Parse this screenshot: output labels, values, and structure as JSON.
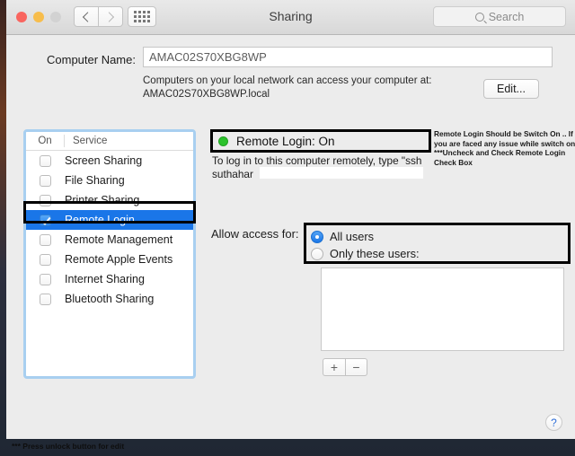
{
  "window": {
    "title": "Sharing",
    "traffic_lights": [
      "close-red",
      "minimize-yellow",
      "zoom-gray"
    ],
    "nav": {
      "back": "back-chevron",
      "forward": "forward-chevron",
      "grid": "show-all-grid"
    },
    "search": {
      "placeholder": "Search",
      "icon": "search-icon"
    }
  },
  "computer_name": {
    "label": "Computer Name:",
    "value": "AMAC02S70XBG8WP",
    "hint_line1": "Computers on your local network can access your computer at:",
    "hint_line2": "AMAC02S70XBG8WP.local",
    "edit_button": "Edit..."
  },
  "services": {
    "header": {
      "on": "On",
      "service": "Service"
    },
    "items": [
      {
        "label": "Screen Sharing",
        "checked": false,
        "selected": false
      },
      {
        "label": "File Sharing",
        "checked": false,
        "selected": false
      },
      {
        "label": "Printer Sharing",
        "checked": false,
        "selected": false
      },
      {
        "label": "Remote Login",
        "checked": true,
        "selected": true
      },
      {
        "label": "Remote Management",
        "checked": false,
        "selected": false
      },
      {
        "label": "Remote Apple Events",
        "checked": false,
        "selected": false
      },
      {
        "label": "Internet Sharing",
        "checked": false,
        "selected": false
      },
      {
        "label": "Bluetooth Sharing",
        "checked": false,
        "selected": false
      }
    ]
  },
  "detail": {
    "status_text": "Remote Login: On",
    "status_color": "#2cc22c",
    "login_hint": "To log in to this computer remotely, type \"ssh suthahar",
    "allow_label": "Allow access for:",
    "radios": [
      {
        "label": "All users",
        "selected": true
      },
      {
        "label": "Only these users:",
        "selected": false
      }
    ],
    "add_button": "+",
    "remove_button": "−"
  },
  "annotations": {
    "note": "Remote Login Should be Switch On .. If you are faced any issue while switch on ***Uncheck and Check Remote Login Check Box",
    "footer": "*** Press unlock button for edit"
  },
  "help": {
    "label": "?"
  },
  "colors": {
    "selection_blue": "#1a76e8",
    "status_green": "#2cc22c",
    "annotation_black": "#000000",
    "focus_ring": "#a8cff0"
  }
}
